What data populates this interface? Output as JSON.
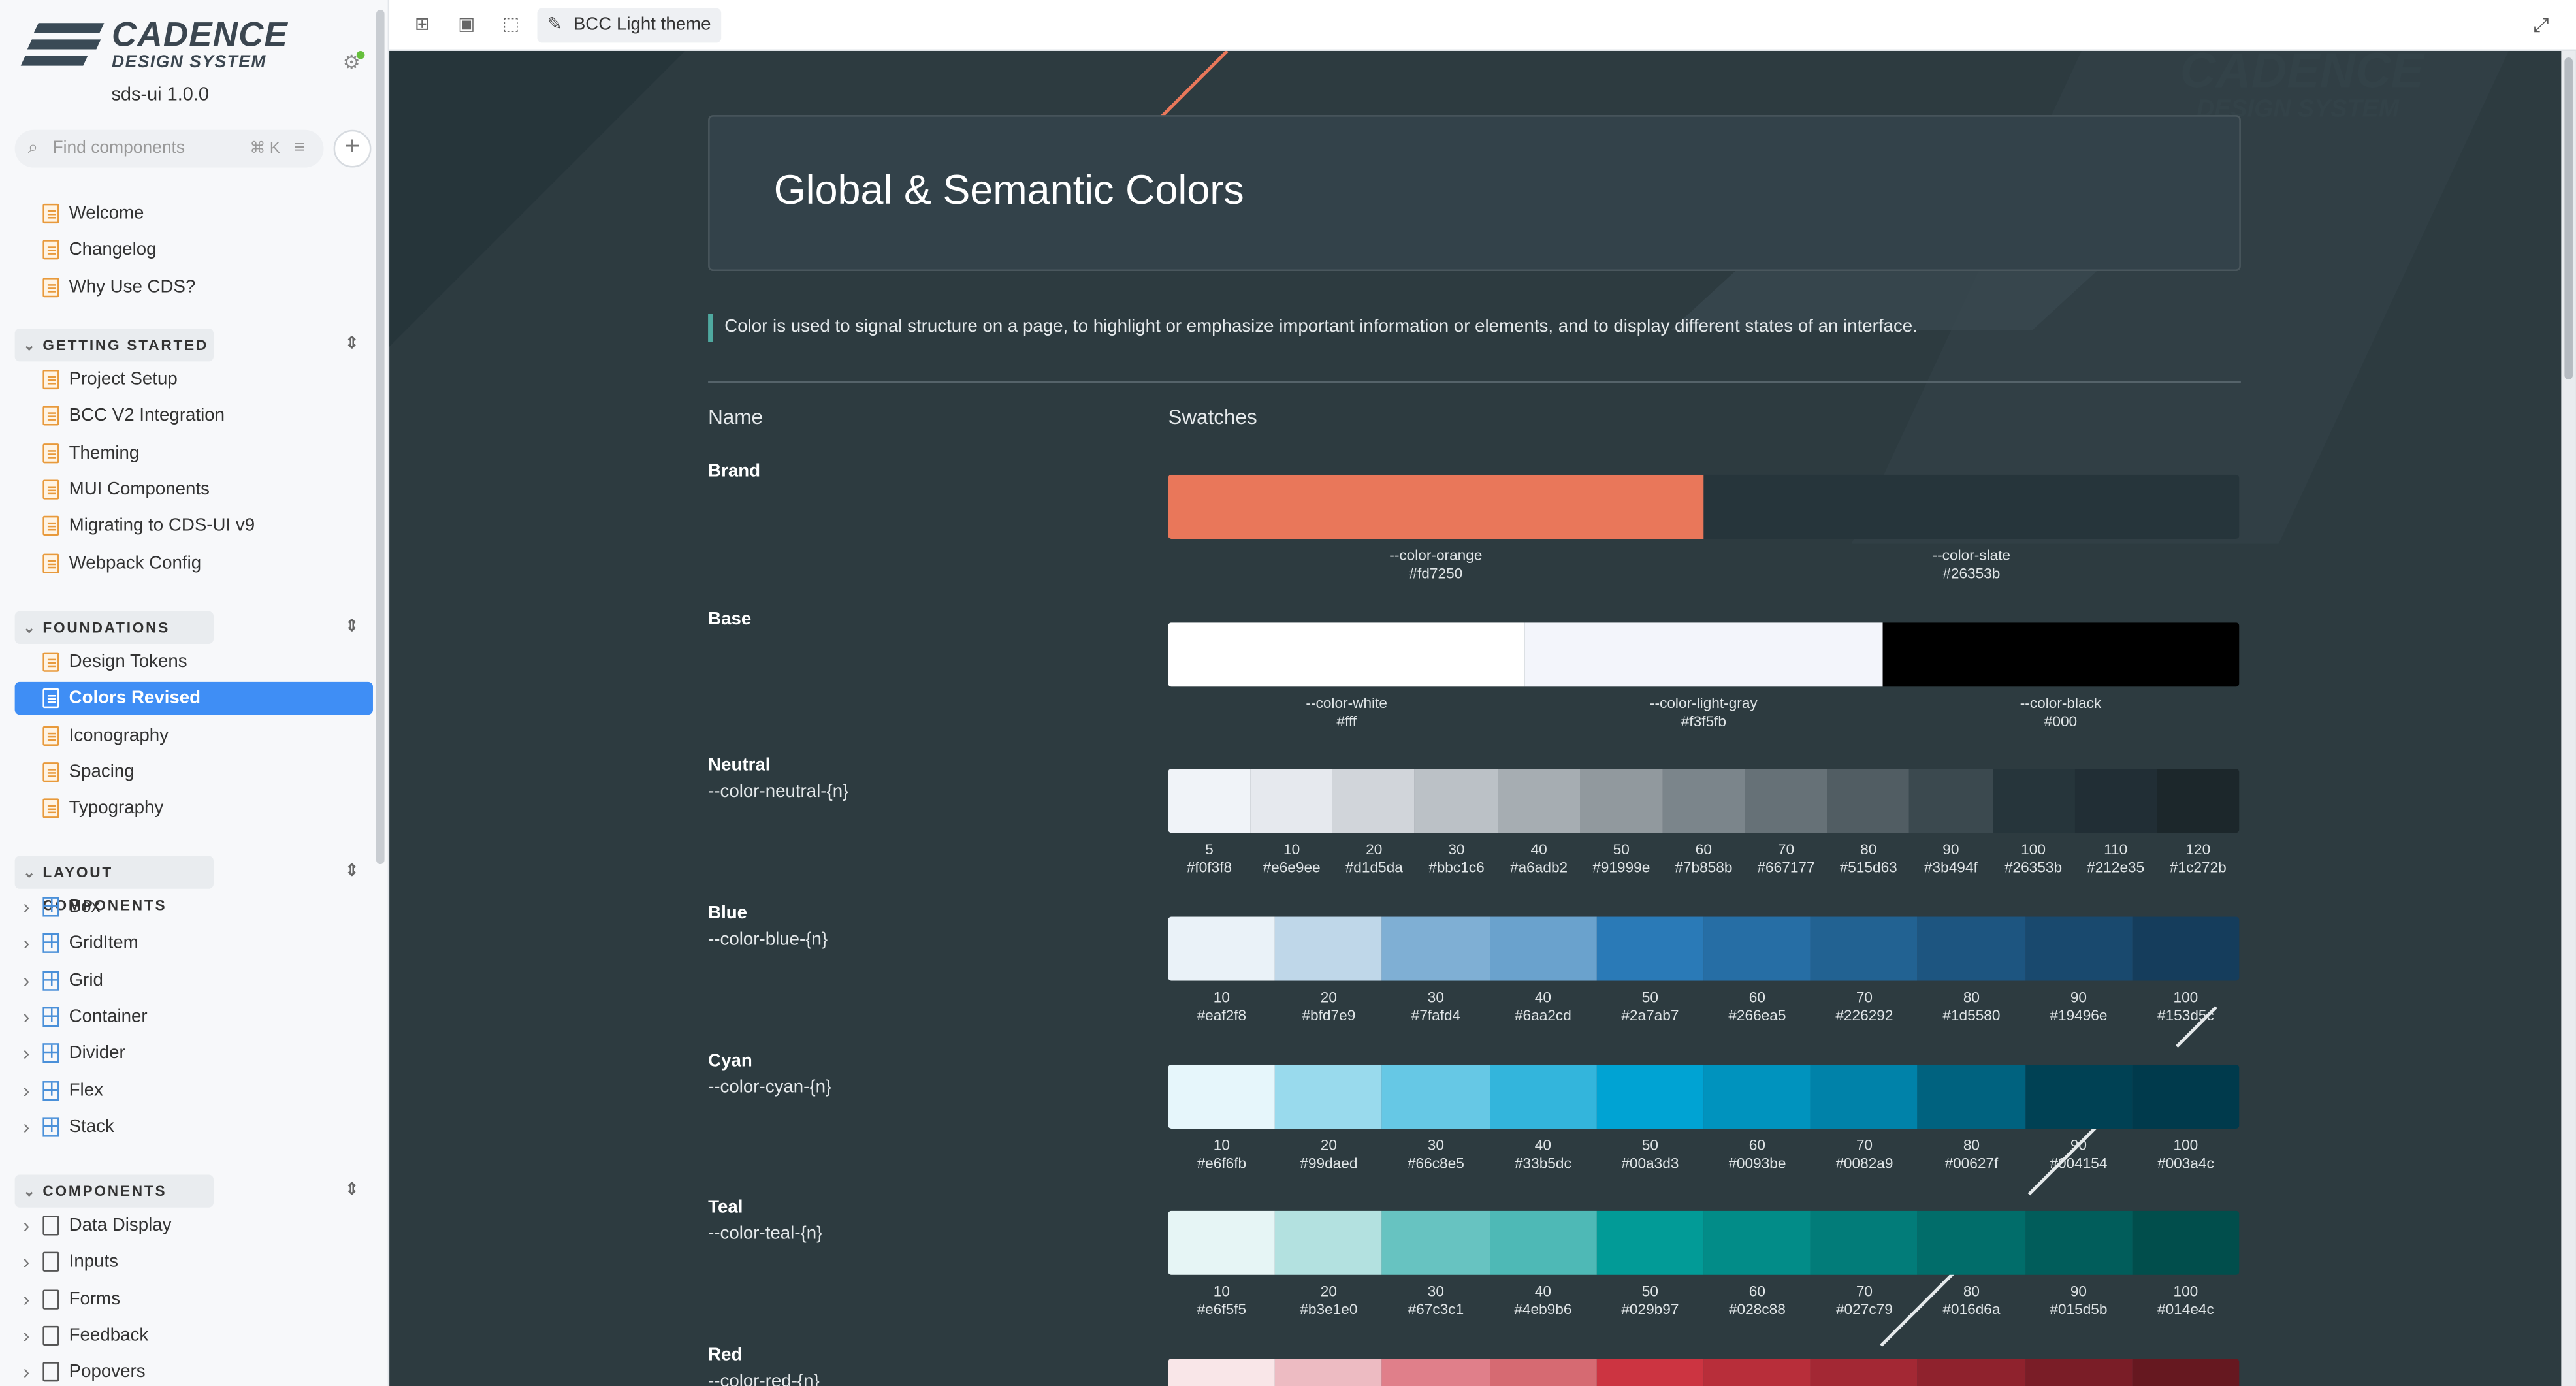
{
  "sidebar": {
    "logo_word1": "CADENCE",
    "logo_word2": "DESIGN SYSTEM",
    "version": "sds-ui 1.0.0",
    "search_placeholder": "Find components",
    "search_shortcut": "⌘ K",
    "top_items": [
      "Welcome",
      "Changelog",
      "Why Use CDS?"
    ],
    "sections": [
      {
        "title": "GETTING STARTED",
        "items": [
          "Project Setup",
          "BCC V2 Integration",
          "Theming",
          "MUI Components",
          "Migrating to CDS-UI v9",
          "Webpack Config"
        ]
      },
      {
        "title": "FOUNDATIONS",
        "items": [
          "Design Tokens",
          "Colors Revised",
          "Iconography",
          "Spacing",
          "Typography"
        ],
        "active": "Colors Revised"
      },
      {
        "title": "LAYOUT COMPONENTS",
        "items": [
          "Box",
          "GridItem",
          "Grid",
          "Container",
          "Divider",
          "Flex",
          "Stack"
        ]
      },
      {
        "title": "COMPONENTS",
        "items": [
          "Data Display",
          "Inputs",
          "Forms",
          "Feedback",
          "Popovers"
        ]
      }
    ]
  },
  "toolbar": {
    "theme_label": "BCC Light theme"
  },
  "main": {
    "title": "Global & Semantic Colors",
    "intro": "Color is used to signal structure on a page, to highlight or emphasize important information or elements, and to display different states of an interface.",
    "col_name": "Name",
    "col_swatches": "Swatches",
    "palettes": [
      {
        "name": "Brand",
        "token": "",
        "swatches": [
          {
            "label": "--color-orange",
            "hex": "#fd7250",
            "color": "#e9775a"
          },
          {
            "label": "--color-slate",
            "hex": "#26353b",
            "color": "#26353b"
          }
        ]
      },
      {
        "name": "Base",
        "token": "",
        "swatches": [
          {
            "label": "--color-white",
            "hex": "#fff",
            "color": "#ffffff"
          },
          {
            "label": "--color-light-gray",
            "hex": "#f3f5fb",
            "color": "#f3f5fb"
          },
          {
            "label": "--color-black",
            "hex": "#000",
            "color": "#000000"
          }
        ]
      },
      {
        "name": "Neutral",
        "token": "--color-neutral-{n}",
        "swatches": [
          {
            "label": "5",
            "hex": "#f0f3f8",
            "color": "#f0f3f8"
          },
          {
            "label": "10",
            "hex": "#e6e9ee",
            "color": "#e6e9ee"
          },
          {
            "label": "20",
            "hex": "#d1d5da",
            "color": "#d1d5da"
          },
          {
            "label": "30",
            "hex": "#bbc1c6",
            "color": "#bbc1c6"
          },
          {
            "label": "40",
            "hex": "#a6adb2",
            "color": "#a6adb2"
          },
          {
            "label": "50",
            "hex": "#91999e",
            "color": "#91999e"
          },
          {
            "label": "60",
            "hex": "#7b858b",
            "color": "#7b858b"
          },
          {
            "label": "70",
            "hex": "#667177",
            "color": "#667177"
          },
          {
            "label": "80",
            "hex": "#515d63",
            "color": "#515d63"
          },
          {
            "label": "90",
            "hex": "#3b494f",
            "color": "#3b494f"
          },
          {
            "label": "100",
            "hex": "#26353b",
            "color": "#26353b"
          },
          {
            "label": "110",
            "hex": "#212e35",
            "color": "#212e35"
          },
          {
            "label": "120",
            "hex": "#1c272b",
            "color": "#1c272b"
          }
        ]
      },
      {
        "name": "Blue",
        "token": "--color-blue-{n}",
        "swatches": [
          {
            "label": "10",
            "hex": "#eaf2f8",
            "color": "#eaf2f8"
          },
          {
            "label": "20",
            "hex": "#bfd7e9",
            "color": "#bfd7e9"
          },
          {
            "label": "30",
            "hex": "#7fafd4",
            "color": "#7fafd4"
          },
          {
            "label": "40",
            "hex": "#6aa2cd",
            "color": "#6aa2cd"
          },
          {
            "label": "50",
            "hex": "#2a7ab7",
            "color": "#2a7ab7"
          },
          {
            "label": "60",
            "hex": "#266ea5",
            "color": "#266ea5"
          },
          {
            "label": "70",
            "hex": "#226292",
            "color": "#226292"
          },
          {
            "label": "80",
            "hex": "#1d5580",
            "color": "#1d5580"
          },
          {
            "label": "90",
            "hex": "#19496e",
            "color": "#19496e"
          },
          {
            "label": "100",
            "hex": "#153d5c",
            "color": "#153d5c"
          }
        ]
      },
      {
        "name": "Cyan",
        "token": "--color-cyan-{n}",
        "swatches": [
          {
            "label": "10",
            "hex": "#e6f6fb",
            "color": "#e6f6fb"
          },
          {
            "label": "20",
            "hex": "#99daed",
            "color": "#99daed"
          },
          {
            "label": "30",
            "hex": "#66c8e5",
            "color": "#66c8e5"
          },
          {
            "label": "40",
            "hex": "#33b5dc",
            "color": "#33b5dc"
          },
          {
            "label": "50",
            "hex": "#00a3d3",
            "color": "#00a3d3"
          },
          {
            "label": "60",
            "hex": "#0093be",
            "color": "#0093be"
          },
          {
            "label": "70",
            "hex": "#0082a9",
            "color": "#0082a9"
          },
          {
            "label": "80",
            "hex": "#00627f",
            "color": "#00627f"
          },
          {
            "label": "90",
            "hex": "#004154",
            "color": "#004154"
          },
          {
            "label": "100",
            "hex": "#003a4c",
            "color": "#003a4c"
          }
        ]
      },
      {
        "name": "Teal",
        "token": "--color-teal-{n}",
        "swatches": [
          {
            "label": "10",
            "hex": "#e6f5f5",
            "color": "#e6f5f5"
          },
          {
            "label": "20",
            "hex": "#b3e1e0",
            "color": "#b3e1e0"
          },
          {
            "label": "30",
            "hex": "#67c3c1",
            "color": "#67c3c1"
          },
          {
            "label": "40",
            "hex": "#4eb9b6",
            "color": "#4eb9b6"
          },
          {
            "label": "50",
            "hex": "#029b97",
            "color": "#029b97"
          },
          {
            "label": "60",
            "hex": "#028c88",
            "color": "#028c88"
          },
          {
            "label": "70",
            "hex": "#027c79",
            "color": "#027c79"
          },
          {
            "label": "80",
            "hex": "#016d6a",
            "color": "#016d6a"
          },
          {
            "label": "90",
            "hex": "#015d5b",
            "color": "#015d5b"
          },
          {
            "label": "100",
            "hex": "#014e4c",
            "color": "#014e4c"
          }
        ]
      },
      {
        "name": "Red",
        "token": "--color-red-{n}",
        "swatches": [
          {
            "label": "",
            "hex": "",
            "color": "#f9e6e8"
          },
          {
            "label": "",
            "hex": "",
            "color": "#edbbc2"
          },
          {
            "label": "",
            "hex": "",
            "color": "#e07f8a"
          },
          {
            "label": "",
            "hex": "",
            "color": "#d66a72"
          },
          {
            "label": "",
            "hex": "",
            "color": "#cc3441"
          },
          {
            "label": "",
            "hex": "",
            "color": "#b82e3a"
          },
          {
            "label": "",
            "hex": "",
            "color": "#a32834"
          },
          {
            "label": "",
            "hex": "",
            "color": "#8f222d"
          },
          {
            "label": "",
            "hex": "",
            "color": "#7a1d27"
          },
          {
            "label": "",
            "hex": "",
            "color": "#661820"
          }
        ]
      }
    ]
  }
}
